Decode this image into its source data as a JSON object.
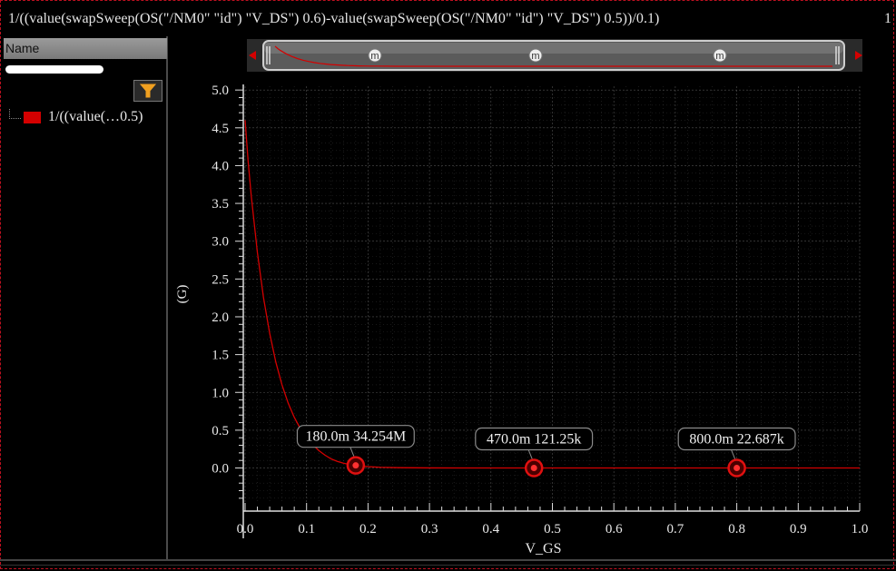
{
  "window": {
    "title": "1/((value(swapSweep(OS(\"/NM0\" \"id\") \"V_DS\") 0.6)-value(swapSweep(OS(\"/NM0\" \"id\") \"V_DS\") 0.5))/0.1)",
    "title_suffix": "1"
  },
  "sidebar": {
    "header": "Name",
    "filter_icon": "funnel-icon",
    "legend": [
      {
        "label": "1/((value(…0.5)",
        "color": "#d40000"
      }
    ]
  },
  "overview": {
    "marker_labels": [
      "m",
      "m",
      "m"
    ]
  },
  "colors": {
    "trace": "#d40000",
    "marker": "#e01010",
    "grid": "#5a5a5a",
    "text": "#e8e8e8"
  },
  "chart_data": {
    "type": "line",
    "xlabel": "V_GS",
    "ylabel": "(G)",
    "xlim": [
      0.0,
      1.0
    ],
    "ylim": [
      -0.45,
      5.05
    ],
    "xticks": [
      "0.0",
      "0.1",
      "0.2",
      "0.3",
      "0.4",
      "0.5",
      "0.6",
      "0.7",
      "0.8",
      "0.9",
      "1.0"
    ],
    "yticks": [
      "5.0",
      "4.5",
      "4.0",
      "3.5",
      "3.0",
      "2.5",
      "2.0",
      "1.5",
      "1.0",
      "0.5",
      "0.0"
    ],
    "grid": true,
    "series": [
      {
        "x": [
          0.0,
          0.005,
          0.01,
          0.02,
          0.03,
          0.04,
          0.05,
          0.06,
          0.07,
          0.08,
          0.09,
          0.1,
          0.11,
          0.12,
          0.13,
          0.14,
          0.15,
          0.16,
          0.17,
          0.18,
          0.2,
          0.22,
          0.25,
          0.3,
          0.35,
          0.4,
          0.47,
          0.55,
          0.65,
          0.8,
          0.9,
          1.0
        ],
        "y": [
          4.6,
          4.05,
          3.6,
          2.85,
          2.25,
          1.78,
          1.4,
          1.1,
          0.86,
          0.67,
          0.52,
          0.4,
          0.31,
          0.23,
          0.17,
          0.12,
          0.088,
          0.064,
          0.046,
          0.034,
          0.018,
          0.009,
          0.004,
          0.0012,
          0.0005,
          0.0003,
          0.00012,
          6e-05,
          4e-05,
          2.3e-05,
          1.5e-05,
          1e-05
        ]
      }
    ],
    "markers": [
      {
        "x": 0.18,
        "y": 0.034254,
        "label": "180.0m 34.254M"
      },
      {
        "x": 0.47,
        "y": 0.00012125,
        "label": "470.0m 121.25k"
      },
      {
        "x": 0.8,
        "y": 2.2687e-05,
        "label": "800.0m 22.687k"
      }
    ]
  }
}
